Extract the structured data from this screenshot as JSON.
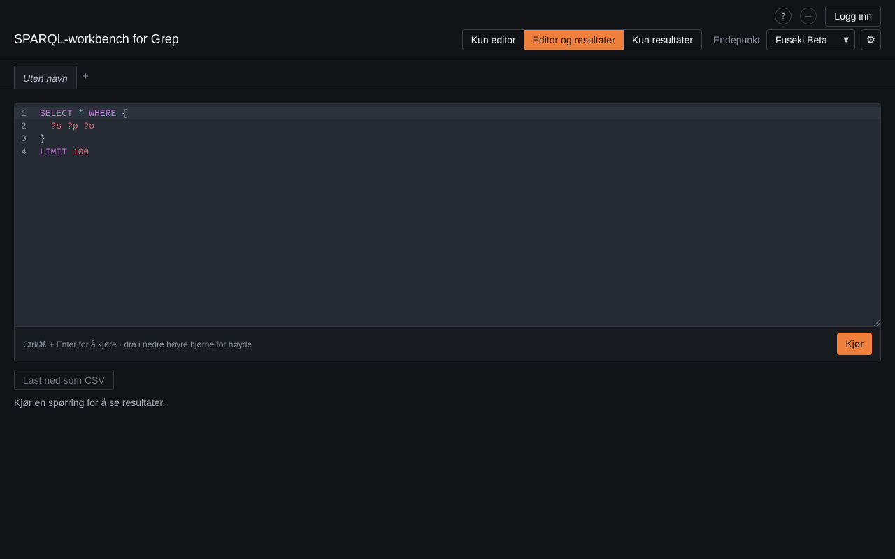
{
  "header": {
    "title": "SPARQL-workbench for Grep",
    "help_icon_glyph": "?",
    "shortcuts_icon_glyph": "⌯",
    "login_label": "Logg inn",
    "view_modes": [
      {
        "label": "Kun editor",
        "active": false
      },
      {
        "label": "Editor og resultater",
        "active": true
      },
      {
        "label": "Kun resultater",
        "active": false
      }
    ],
    "endpoint_label": "Endepunkt",
    "endpoint_selected": "Fuseki Beta",
    "settings_icon_glyph": "⚙"
  },
  "tabs": {
    "items": [
      {
        "label": "Uten navn",
        "active": true
      }
    ],
    "add_label": "+"
  },
  "editor": {
    "lines": [
      {
        "number": "1",
        "tokens": [
          {
            "t": "SELECT",
            "c": "kw"
          },
          {
            "t": " ",
            "c": ""
          },
          {
            "t": "*",
            "c": "op"
          },
          {
            "t": " ",
            "c": ""
          },
          {
            "t": "WHERE",
            "c": "kw"
          },
          {
            "t": " {",
            "c": ""
          }
        ]
      },
      {
        "number": "2",
        "tokens": [
          {
            "t": "  ",
            "c": ""
          },
          {
            "t": "?s",
            "c": "var"
          },
          {
            "t": " ",
            "c": ""
          },
          {
            "t": "?p",
            "c": "var"
          },
          {
            "t": " ",
            "c": ""
          },
          {
            "t": "?o",
            "c": "var"
          }
        ]
      },
      {
        "number": "3",
        "tokens": [
          {
            "t": "}",
            "c": ""
          }
        ]
      },
      {
        "number": "4",
        "tokens": [
          {
            "t": "LIMIT",
            "c": "kw"
          },
          {
            "t": " ",
            "c": ""
          },
          {
            "t": "100",
            "c": "num"
          }
        ]
      }
    ],
    "hint": "Ctrl/⌘ + Enter for å kjøre · dra i nedre høyre hjørne for høyde",
    "run_label": "Kjør"
  },
  "results": {
    "download_csv_label": "Last ned som CSV",
    "empty_message": "Kjør en spørring for å se resultater."
  },
  "colors": {
    "accent": "#f07f3c",
    "background": "#111317",
    "editor_background": "#262b33"
  }
}
